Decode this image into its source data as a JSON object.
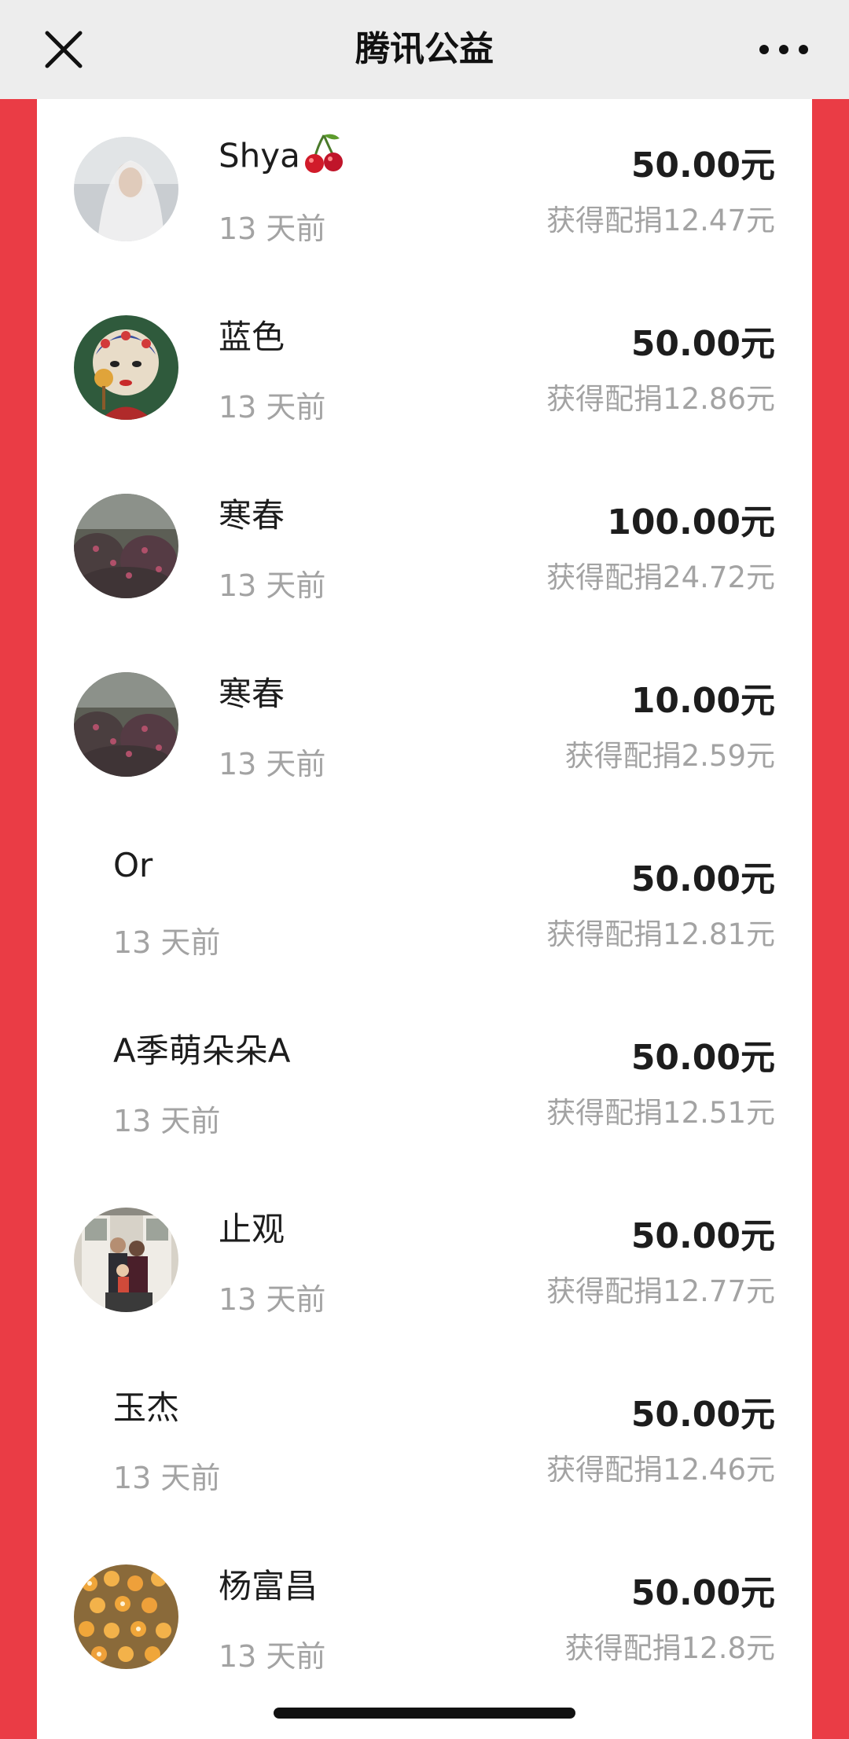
{
  "nav": {
    "title": "腾讯公益",
    "close_icon": "close-icon",
    "more_icon": "more-dots-icon"
  },
  "colors": {
    "background_red": "#ea3c45",
    "nav_bg": "#ededed",
    "text_dark": "#1d1d1d",
    "text_gray": "#a3a3a3"
  },
  "donors": [
    {
      "name": "Shya",
      "name_emoji": "cherry",
      "time": "13 天前",
      "amount": "50.00元",
      "match": "获得配捐12.47元",
      "avatar": "veil-photo"
    },
    {
      "name": "蓝色",
      "time": "13 天前",
      "amount": "50.00元",
      "match": "获得配捐12.86元",
      "avatar": "opera-mask-illustration"
    },
    {
      "name": "寒春",
      "time": "13 天前",
      "amount": "100.00元",
      "match": "获得配捐24.72元",
      "avatar": "flower-garden-photo"
    },
    {
      "name": "寒春",
      "time": "13 天前",
      "amount": "10.00元",
      "match": "获得配捐2.59元",
      "avatar": "flower-garden-photo"
    },
    {
      "name": "Or",
      "time": "13 天前",
      "amount": "50.00元",
      "match": "获得配捐12.81元",
      "avatar": ""
    },
    {
      "name": "A季萌朵朵A",
      "time": "13 天前",
      "amount": "50.00元",
      "match": "获得配捐12.51元",
      "avatar": ""
    },
    {
      "name": "止观",
      "time": "13 天前",
      "amount": "50.00元",
      "match": "获得配捐12.77元",
      "avatar": "family-photo"
    },
    {
      "name": "玉杰",
      "time": "13 天前",
      "amount": "50.00元",
      "match": "获得配捐12.46元",
      "avatar": ""
    },
    {
      "name": "杨富昌",
      "time": "13 天前",
      "amount": "50.00元",
      "match": "获得配捐12.8元",
      "avatar": "orange-flowers-photo"
    }
  ]
}
